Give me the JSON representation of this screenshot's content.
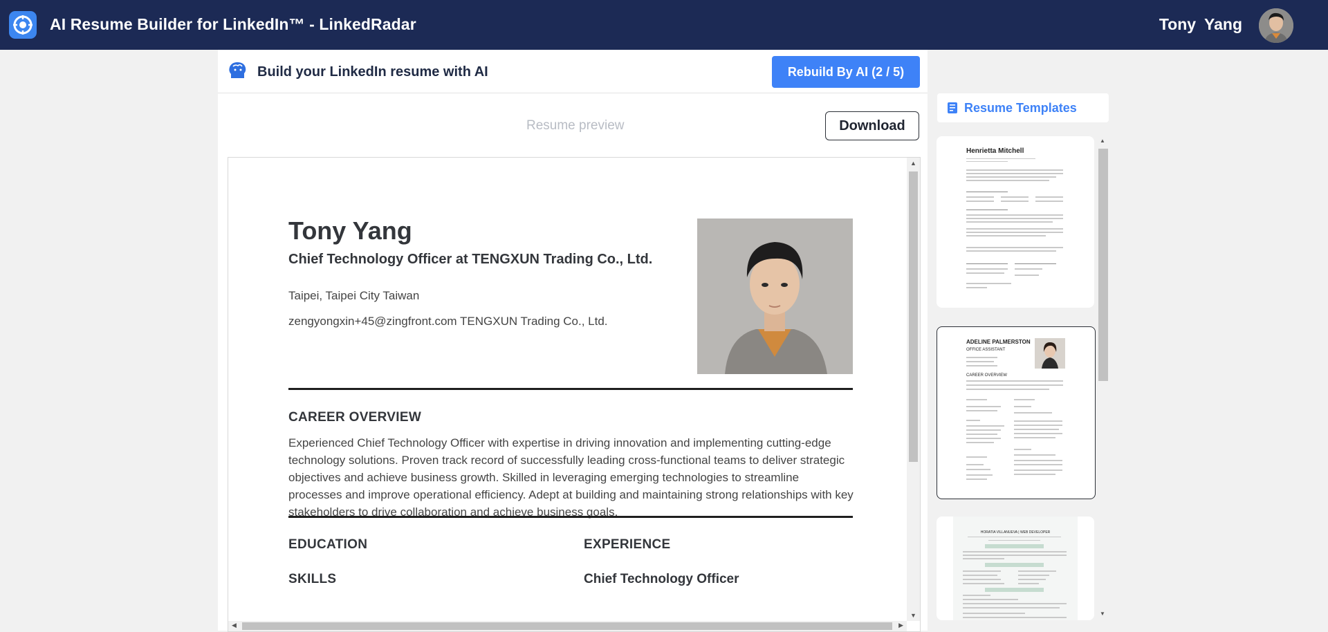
{
  "app": {
    "title": "AI Resume Builder for LinkedIn™ - LinkedRadar",
    "user_name": "Tony  Yang"
  },
  "builder": {
    "heading": "Build your LinkedIn resume with AI",
    "rebuild_label": "Rebuild By AI (2 / 5)",
    "preview_label": "Resume preview",
    "download_label": "Download"
  },
  "resume": {
    "name": "Tony Yang",
    "headline": "Chief Technology Officer at TENGXUN Trading Co., Ltd.",
    "location": "Taipei, Taipei City Taiwan",
    "contact": "zengyongxin+45@zingfront.com TENGXUN Trading Co., Ltd.",
    "career_overview_title": "CAREER OVERVIEW",
    "career_overview_text": "Experienced Chief Technology Officer with expertise in driving innovation and implementing cutting-edge technology solutions. Proven track record of successfully leading cross-functional teams to deliver strategic objectives and achieve business growth. Skilled in leveraging emerging technologies to streamline processes and improve operational efficiency. Adept at building and maintaining strong relationships with key stakeholders to drive collaboration and achieve business goals.",
    "education_title": "EDUCATION",
    "skills_title": "SKILLS",
    "experience_title": "EXPERIENCE",
    "experience_role": "Chief Technology Officer"
  },
  "templates": {
    "title": "Resume Templates",
    "items": [
      {
        "name": "Henrietta Mitchell",
        "selected": false
      },
      {
        "name": "ADELINE PALMERSTON",
        "subtitle": "OFFICE ASSISTANT",
        "section": "CAREER OVERVIEW",
        "selected": true
      },
      {
        "name": "HORATIA VILLANUEVA | WEB DEVELOPER",
        "selected": false
      }
    ]
  },
  "colors": {
    "topbar": "#1c2a55",
    "accent": "#3e82f7"
  },
  "icons": [
    "app-logo-icon",
    "ai-head-icon",
    "document-icon"
  ]
}
